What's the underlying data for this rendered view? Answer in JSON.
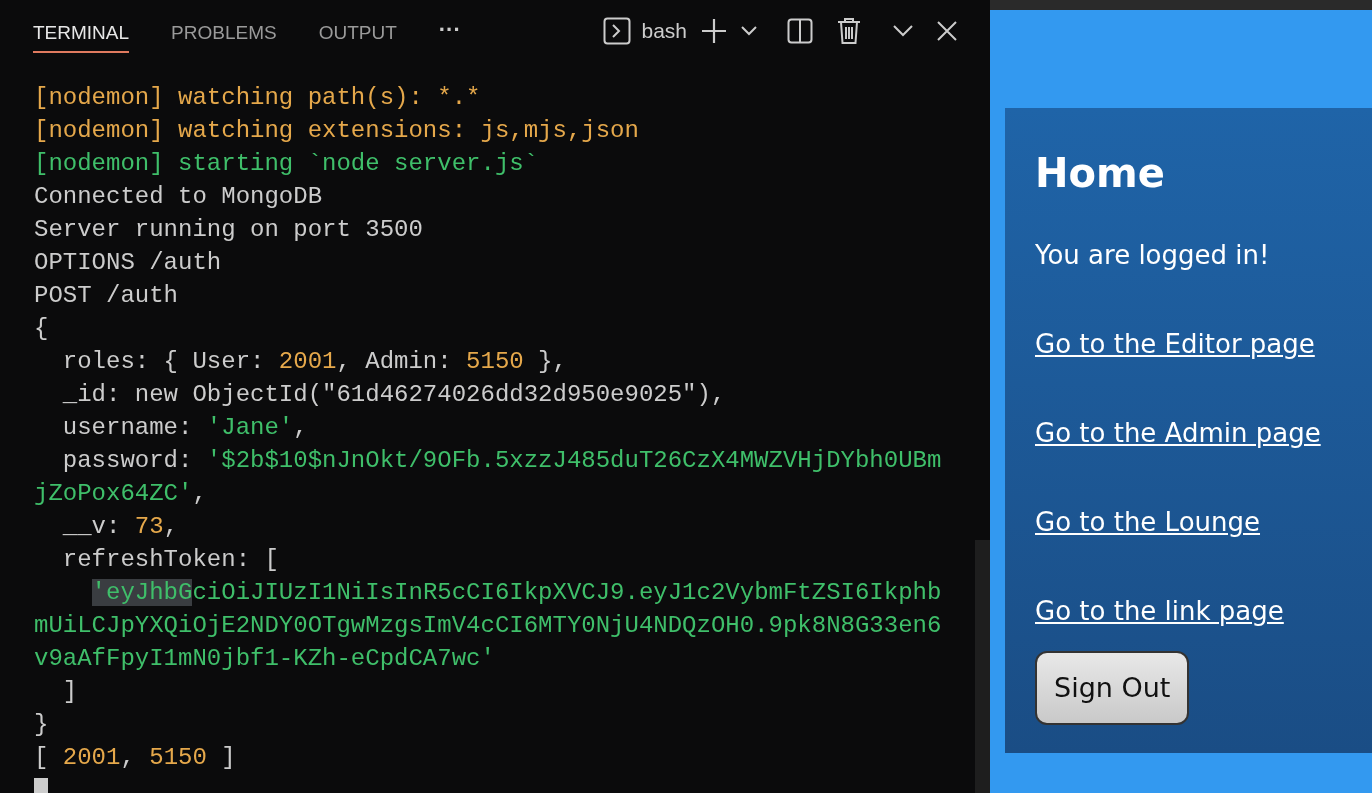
{
  "panel_tabs": [
    {
      "label": "TERMINAL",
      "selected": true
    },
    {
      "label": "PROBLEMS",
      "selected": false
    },
    {
      "label": "OUTPUT",
      "selected": false
    }
  ],
  "more_menu": "···",
  "shell_label": "bash",
  "terminal_lines": [
    [
      {
        "text": "[nodemon] watching path(s): *.*",
        "kind": "warn"
      }
    ],
    [
      {
        "text": "[nodemon] watching extensions: js,mjs,json",
        "kind": "warn"
      }
    ],
    [
      {
        "text": "[nodemon] starting `node server.js`",
        "kind": "ok"
      }
    ],
    [
      {
        "text": "Connected to MongoDB",
        "kind": "plain"
      }
    ],
    [
      {
        "text": "Server running on port 3500",
        "kind": "plain"
      }
    ],
    [
      {
        "text": "OPTIONS /auth",
        "kind": "plain"
      }
    ],
    [
      {
        "text": "POST /auth",
        "kind": "plain"
      }
    ],
    [
      {
        "text": "{",
        "kind": "plain"
      }
    ],
    [
      {
        "text": "  roles: { User: ",
        "kind": "plain"
      },
      {
        "text": "2001",
        "kind": "number"
      },
      {
        "text": ", Admin: ",
        "kind": "plain"
      },
      {
        "text": "5150",
        "kind": "number"
      },
      {
        "text": " },",
        "kind": "plain"
      }
    ],
    [
      {
        "text": "  _id: new ObjectId(\"61d46274026dd32d950e9025\"),",
        "kind": "plain"
      }
    ],
    [
      {
        "text": "  username: ",
        "kind": "plain"
      },
      {
        "text": "'Jane'",
        "kind": "string"
      },
      {
        "text": ",",
        "kind": "plain"
      }
    ],
    [
      {
        "text": "  password: ",
        "kind": "plain"
      },
      {
        "text": "'$2b$10$nJnOkt/9OFb.5xzzJ485duT26CzX4MWZVHjDYbh0UBm",
        "kind": "string"
      }
    ],
    [
      {
        "text": "jZoPox64ZC'",
        "kind": "string"
      },
      {
        "text": ",",
        "kind": "plain"
      }
    ],
    [
      {
        "text": "  __v: ",
        "kind": "plain"
      },
      {
        "text": "73",
        "kind": "number"
      },
      {
        "text": ",",
        "kind": "plain"
      }
    ],
    [
      {
        "text": "  refreshToken: [",
        "kind": "plain"
      }
    ],
    [
      {
        "text": "    'eyJhbG",
        "kind": "highlight"
      },
      {
        "text": "ciOiJIUzI1NiIsInR5cCI6IkpXVCJ9.eyJ1c2VybmFtZSI6Ikphb",
        "kind": "string"
      }
    ],
    [
      {
        "text": "mUiLCJpYXQiOjE2NDY0OTgwMzgsImV4cCI6MTY0NjU4NDQzOH0.9pk8N8G33en6",
        "kind": "string"
      }
    ],
    [
      {
        "text": "v9aAfFpyI1mN0jbf1-KZh-eCpdCA7wc'",
        "kind": "string"
      }
    ],
    [
      {
        "text": "  ]",
        "kind": "plain"
      }
    ],
    [
      {
        "text": "}",
        "kind": "plain"
      }
    ],
    [
      {
        "text": "[ ",
        "kind": "plain"
      },
      {
        "text": "2001",
        "kind": "number"
      },
      {
        "text": ", ",
        "kind": "plain"
      },
      {
        "text": "5150",
        "kind": "number"
      },
      {
        "text": " ]",
        "kind": "plain"
      }
    ]
  ],
  "page": {
    "heading": "Home",
    "message": "You are logged in!",
    "links": [
      "Go to the Editor page",
      "Go to the Admin page",
      "Go to the Lounge",
      "Go to the link page"
    ],
    "sign_out_button": "Sign Out"
  }
}
